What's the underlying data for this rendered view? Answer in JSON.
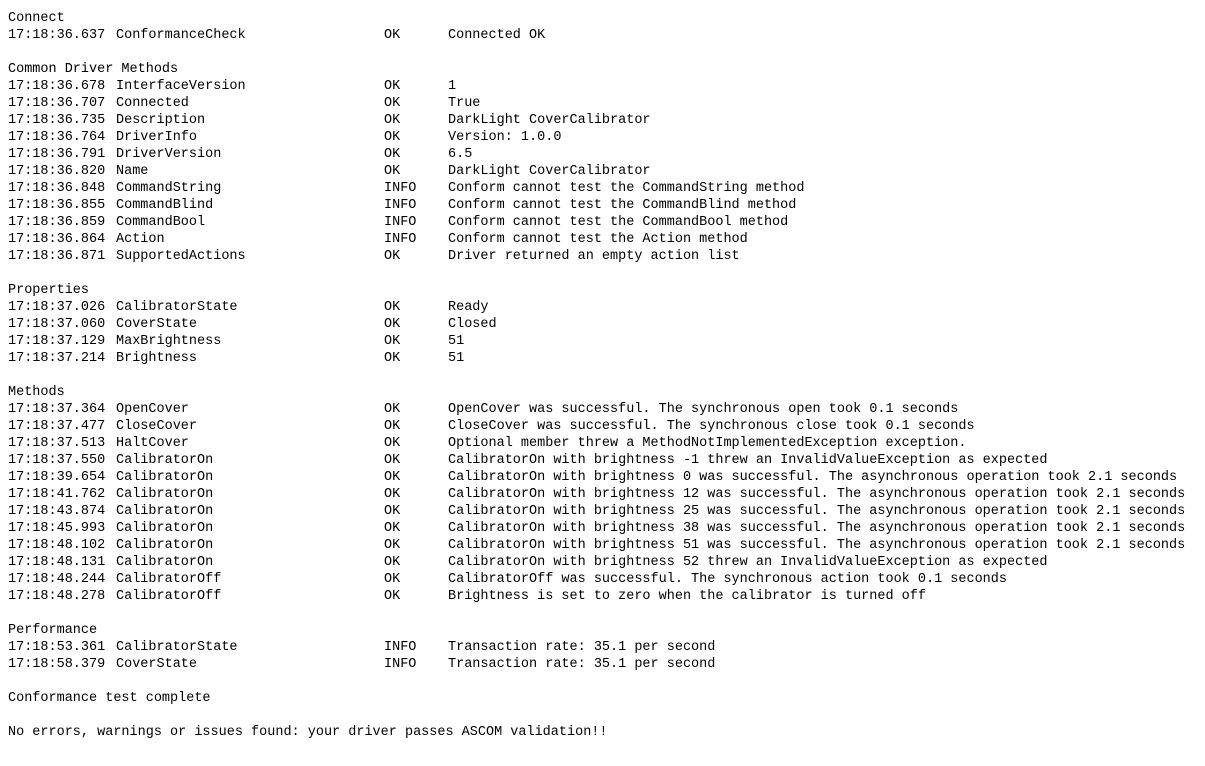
{
  "sections": [
    {
      "title": "Connect",
      "rows": [
        {
          "ts": "17:18:36.637",
          "name": "ConformanceCheck",
          "status": "OK",
          "msg": "Connected OK"
        }
      ]
    },
    {
      "title": "Common Driver Methods",
      "rows": [
        {
          "ts": "17:18:36.678",
          "name": "InterfaceVersion",
          "status": "OK",
          "msg": "1"
        },
        {
          "ts": "17:18:36.707",
          "name": "Connected",
          "status": "OK",
          "msg": "True"
        },
        {
          "ts": "17:18:36.735",
          "name": "Description",
          "status": "OK",
          "msg": "DarkLight CoverCalibrator"
        },
        {
          "ts": "17:18:36.764",
          "name": "DriverInfo",
          "status": "OK",
          "msg": "Version: 1.0.0"
        },
        {
          "ts": "17:18:36.791",
          "name": "DriverVersion",
          "status": "OK",
          "msg": "6.5"
        },
        {
          "ts": "17:18:36.820",
          "name": "Name",
          "status": "OK",
          "msg": "DarkLight CoverCalibrator"
        },
        {
          "ts": "17:18:36.848",
          "name": "CommandString",
          "status": "INFO",
          "msg": "Conform cannot test the CommandString method"
        },
        {
          "ts": "17:18:36.855",
          "name": "CommandBlind",
          "status": "INFO",
          "msg": "Conform cannot test the CommandBlind method"
        },
        {
          "ts": "17:18:36.859",
          "name": "CommandBool",
          "status": "INFO",
          "msg": "Conform cannot test the CommandBool method"
        },
        {
          "ts": "17:18:36.864",
          "name": "Action",
          "status": "INFO",
          "msg": "Conform cannot test the Action method"
        },
        {
          "ts": "17:18:36.871",
          "name": "SupportedActions",
          "status": "OK",
          "msg": "Driver returned an empty action list"
        }
      ]
    },
    {
      "title": "Properties",
      "rows": [
        {
          "ts": "17:18:37.026",
          "name": "CalibratorState",
          "status": "OK",
          "msg": "Ready"
        },
        {
          "ts": "17:18:37.060",
          "name": "CoverState",
          "status": "OK",
          "msg": "Closed"
        },
        {
          "ts": "17:18:37.129",
          "name": "MaxBrightness",
          "status": "OK",
          "msg": "51"
        },
        {
          "ts": "17:18:37.214",
          "name": "Brightness",
          "status": "OK",
          "msg": "51"
        }
      ]
    },
    {
      "title": "Methods",
      "rows": [
        {
          "ts": "17:18:37.364",
          "name": "OpenCover",
          "status": "OK",
          "msg": "OpenCover was successful. The synchronous open took 0.1 seconds"
        },
        {
          "ts": "17:18:37.477",
          "name": "CloseCover",
          "status": "OK",
          "msg": "CloseCover was successful. The synchronous close took 0.1 seconds"
        },
        {
          "ts": "17:18:37.513",
          "name": "HaltCover",
          "status": "OK",
          "msg": "Optional member threw a MethodNotImplementedException exception."
        },
        {
          "ts": "17:18:37.550",
          "name": "CalibratorOn",
          "status": "OK",
          "msg": "CalibratorOn with brightness -1 threw an InvalidValueException as expected"
        },
        {
          "ts": "17:18:39.654",
          "name": "CalibratorOn",
          "status": "OK",
          "msg": "CalibratorOn with brightness 0 was successful. The asynchronous operation took 2.1 seconds"
        },
        {
          "ts": "17:18:41.762",
          "name": "CalibratorOn",
          "status": "OK",
          "msg": "CalibratorOn with brightness 12 was successful. The asynchronous operation took 2.1 seconds"
        },
        {
          "ts": "17:18:43.874",
          "name": "CalibratorOn",
          "status": "OK",
          "msg": "CalibratorOn with brightness 25 was successful. The asynchronous operation took 2.1 seconds"
        },
        {
          "ts": "17:18:45.993",
          "name": "CalibratorOn",
          "status": "OK",
          "msg": "CalibratorOn with brightness 38 was successful. The asynchronous operation took 2.1 seconds"
        },
        {
          "ts": "17:18:48.102",
          "name": "CalibratorOn",
          "status": "OK",
          "msg": "CalibratorOn with brightness 51 was successful. The asynchronous operation took 2.1 seconds"
        },
        {
          "ts": "17:18:48.131",
          "name": "CalibratorOn",
          "status": "OK",
          "msg": "CalibratorOn with brightness 52 threw an InvalidValueException as expected"
        },
        {
          "ts": "17:18:48.244",
          "name": "CalibratorOff",
          "status": "OK",
          "msg": "CalibratorOff was successful. The synchronous action took 0.1 seconds"
        },
        {
          "ts": "17:18:48.278",
          "name": "CalibratorOff",
          "status": "OK",
          "msg": "Brightness is set to zero when the calibrator is turned off"
        }
      ]
    },
    {
      "title": "Performance",
      "rows": [
        {
          "ts": "17:18:53.361",
          "name": "CalibratorState",
          "status": "INFO",
          "msg": "Transaction rate: 35.1 per second"
        },
        {
          "ts": "17:18:58.379",
          "name": "CoverState",
          "status": "INFO",
          "msg": "Transaction rate: 35.1 per second"
        }
      ]
    }
  ],
  "footer": {
    "line1": "Conformance test complete",
    "line2": "No errors, warnings or issues found: your driver passes ASCOM validation!!"
  }
}
